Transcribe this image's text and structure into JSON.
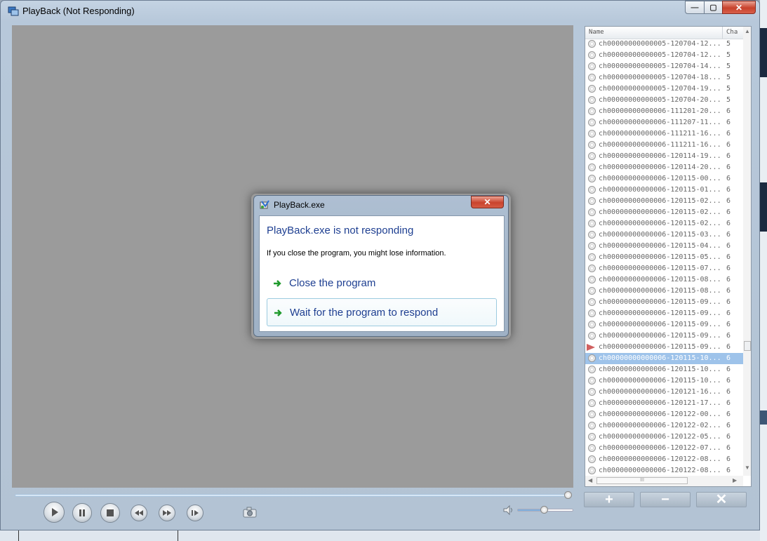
{
  "window": {
    "title": "PlayBack (Not Responding)",
    "buttons": {
      "minimize": "—",
      "maximize": "▢",
      "close": "✕"
    }
  },
  "playlist": {
    "columns": {
      "name": "Name",
      "channel": "Cha"
    },
    "rows": [
      {
        "name": "ch00000000000005-120704-12...",
        "ch": "5"
      },
      {
        "name": "ch00000000000005-120704-12...",
        "ch": "5"
      },
      {
        "name": "ch00000000000005-120704-14...",
        "ch": "5"
      },
      {
        "name": "ch00000000000005-120704-18...",
        "ch": "5"
      },
      {
        "name": "ch00000000000005-120704-19...",
        "ch": "5"
      },
      {
        "name": "ch00000000000005-120704-20...",
        "ch": "5"
      },
      {
        "name": "ch00000000000006-111201-20...",
        "ch": "6"
      },
      {
        "name": "ch00000000000006-111207-11...",
        "ch": "6"
      },
      {
        "name": "ch00000000000006-111211-16...",
        "ch": "6"
      },
      {
        "name": "ch00000000000006-111211-16...",
        "ch": "6"
      },
      {
        "name": "ch00000000000006-120114-19...",
        "ch": "6"
      },
      {
        "name": "ch00000000000006-120114-20...",
        "ch": "6"
      },
      {
        "name": "ch00000000000006-120115-00...",
        "ch": "6"
      },
      {
        "name": "ch00000000000006-120115-01...",
        "ch": "6"
      },
      {
        "name": "ch00000000000006-120115-02...",
        "ch": "6"
      },
      {
        "name": "ch00000000000006-120115-02...",
        "ch": "6"
      },
      {
        "name": "ch00000000000006-120115-02...",
        "ch": "6"
      },
      {
        "name": "ch00000000000006-120115-03...",
        "ch": "6"
      },
      {
        "name": "ch00000000000006-120115-04...",
        "ch": "6"
      },
      {
        "name": "ch00000000000006-120115-05...",
        "ch": "6"
      },
      {
        "name": "ch00000000000006-120115-07...",
        "ch": "6"
      },
      {
        "name": "ch00000000000006-120115-08...",
        "ch": "6"
      },
      {
        "name": "ch00000000000006-120115-08...",
        "ch": "6"
      },
      {
        "name": "ch00000000000006-120115-09...",
        "ch": "6"
      },
      {
        "name": "ch00000000000006-120115-09...",
        "ch": "6"
      },
      {
        "name": "ch00000000000006-120115-09...",
        "ch": "6"
      },
      {
        "name": "ch00000000000006-120115-09...",
        "ch": "6"
      },
      {
        "name": "ch00000000000006-120115-09...",
        "ch": "6",
        "playing": true
      },
      {
        "name": "ch00000000000006-120115-10...",
        "ch": "6",
        "selected": true
      },
      {
        "name": "ch00000000000006-120115-10...",
        "ch": "6"
      },
      {
        "name": "ch00000000000006-120115-10...",
        "ch": "6"
      },
      {
        "name": "ch00000000000006-120121-16...",
        "ch": "6"
      },
      {
        "name": "ch00000000000006-120121-17...",
        "ch": "6"
      },
      {
        "name": "ch00000000000006-120122-00...",
        "ch": "6"
      },
      {
        "name": "ch00000000000006-120122-02...",
        "ch": "6"
      },
      {
        "name": "ch00000000000006-120122-05...",
        "ch": "6"
      },
      {
        "name": "ch00000000000006-120122-07...",
        "ch": "6"
      },
      {
        "name": "ch00000000000006-120122-08...",
        "ch": "6"
      },
      {
        "name": "ch00000000000006-120122-08...",
        "ch": "6"
      }
    ],
    "scroll_grip": "III",
    "add_label": "+",
    "remove_label": "−",
    "clear_label": "✕"
  },
  "controls": {
    "seek_fraction": 1.0,
    "volume_fraction": 0.5,
    "icons": [
      "play-icon",
      "pause-icon",
      "stop-icon",
      "rewind-icon",
      "fast-forward-icon",
      "frame-step-icon",
      "camera-icon",
      "speaker-icon"
    ]
  },
  "dialog": {
    "title": "PlayBack.exe",
    "close": "✕",
    "heading": "PlayBack.exe is not responding",
    "message": "If you close the program, you might lose information.",
    "options": {
      "close_program": "Close the program",
      "wait": "Wait for the program to respond"
    }
  },
  "colors": {
    "heading_blue": "#1e3f91",
    "video_bg": "#9b9b9b",
    "selection": "#9ec3ea",
    "close_red": "#c9432d"
  }
}
